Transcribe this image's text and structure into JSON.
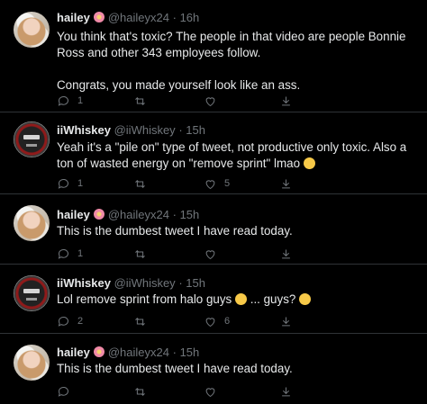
{
  "tweets": [
    {
      "name": "hailey",
      "handle": "@haileyx24",
      "time": "16h",
      "lines": [
        "You think that's toxic? The people in that video are people Bonnie Ross and other 343 employees follow.",
        "Congrats, you made yourself look like an ass."
      ],
      "replies": "1",
      "retweets": "",
      "likes": ""
    },
    {
      "name": "iiWhiskey",
      "handle": "@iiWhiskey",
      "time": "15h",
      "lines": [
        "Yeah it's a \"pile on\" type of tweet, not productive only toxic. Also a ton of wasted energy on \"remove sprint\" lmao"
      ],
      "replies": "1",
      "retweets": "",
      "likes": "5"
    },
    {
      "name": "hailey",
      "handle": "@haileyx24",
      "time": "15h",
      "lines": [
        "This is the dumbest tweet I have read today."
      ],
      "replies": "1",
      "retweets": "",
      "likes": ""
    },
    {
      "name": "iiWhiskey",
      "handle": "@iiWhiskey",
      "time": "15h",
      "lines": [
        "Lol remove sprint from halo guys",
        "... guys?"
      ],
      "replies": "2",
      "retweets": "",
      "likes": "6"
    },
    {
      "name": "hailey",
      "handle": "@haileyx24",
      "time": "15h",
      "lines": [
        "This is the dumbest tweet I have read today."
      ],
      "replies": "",
      "retweets": "",
      "likes": ""
    }
  ],
  "separator": "·",
  "icons": [
    "reply-icon",
    "retweet-icon",
    "like-icon",
    "share-icon",
    "flower-emoji",
    "rofl-emoji",
    "joy-emoji"
  ]
}
